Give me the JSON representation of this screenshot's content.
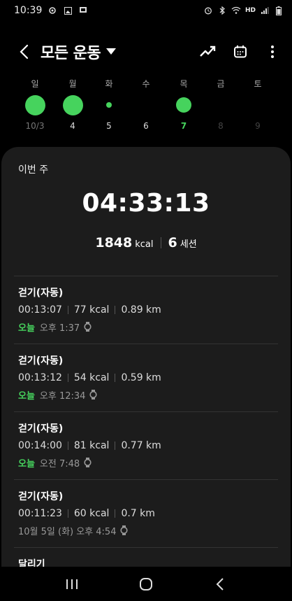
{
  "status_bar": {
    "time": "10:39",
    "network": "HD",
    "left_icons": [
      "notification-icon",
      "gallery-icon",
      "cast-icon"
    ],
    "right_icons": [
      "alarm-icon",
      "bluetooth-icon",
      "wifi-icon",
      "signal-icon",
      "battery-icon"
    ]
  },
  "header": {
    "title": "모든 운동",
    "actions": [
      "trend-chart-icon",
      "calendar-icon",
      "more-options-icon"
    ]
  },
  "week": {
    "days": [
      {
        "name": "일",
        "num": "10/3",
        "dot": "big",
        "num_style": "muted"
      },
      {
        "name": "월",
        "num": "4",
        "dot": "big",
        "num_style": ""
      },
      {
        "name": "화",
        "num": "5",
        "dot": "small",
        "num_style": ""
      },
      {
        "name": "수",
        "num": "6",
        "dot": "",
        "num_style": ""
      },
      {
        "name": "목",
        "num": "7",
        "dot": "mid",
        "num_style": "today"
      },
      {
        "name": "금",
        "num": "8",
        "dot": "",
        "num_style": "faded"
      },
      {
        "name": "토",
        "num": "9",
        "dot": "",
        "num_style": "faded"
      }
    ]
  },
  "summary": {
    "label": "이번 주",
    "total_time": "04:33:13",
    "kcal": "1848",
    "kcal_unit": "kcal",
    "sessions": "6",
    "sessions_unit": "세션"
  },
  "entries": [
    {
      "title": "걷기(자동)",
      "duration": "00:13:07",
      "kcal": "77 kcal",
      "distance": "0.89 km",
      "today": "오늘",
      "time": "오후 1:37"
    },
    {
      "title": "걷기(자동)",
      "duration": "00:13:12",
      "kcal": "54 kcal",
      "distance": "0.59 km",
      "today": "오늘",
      "time": "오후 12:34"
    },
    {
      "title": "걷기(자동)",
      "duration": "00:14:00",
      "kcal": "81 kcal",
      "distance": "0.77 km",
      "today": "오늘",
      "time": "오전 7:48"
    },
    {
      "title": "걷기(자동)",
      "duration": "00:11:23",
      "kcal": "60 kcal",
      "distance": "0.7 km",
      "today": "",
      "time": "10월 5일 (화) 오후 4:54"
    }
  ],
  "last_entry_title": "달리기",
  "nav": [
    "recent-apps-icon",
    "home-icon",
    "back-nav-icon"
  ],
  "colors": {
    "accent": "#46d35d",
    "panel": "#1c1c1c",
    "background": "#000000"
  }
}
